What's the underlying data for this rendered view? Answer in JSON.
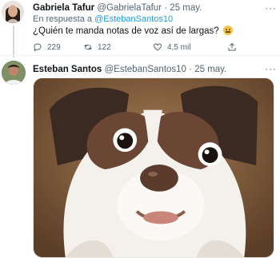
{
  "reply": {
    "author_name": "Gabriela Tafur",
    "handle": "@GabrielaTafur",
    "separator": "·",
    "time": "25 may.",
    "reply_prefix": "En respuesta a",
    "reply_mention": "@EstebanSantos10",
    "text": "¿Quién te manda notas de voz así de largas?",
    "emoji": "thinking-face",
    "stats": {
      "replies": "229",
      "retweets": "122",
      "likes": "4,5 mil"
    }
  },
  "original": {
    "author_name": "Esteban Santos",
    "handle": "@EstebanSantos10",
    "separator": "·",
    "time": "25 may.",
    "media": "dog-photo"
  },
  "icons": {
    "reply": "comment-icon",
    "retweet": "retweet-icon",
    "like": "heart-icon",
    "share": "share-icon",
    "more": "more-icon"
  },
  "colors": {
    "text": "#0f1419",
    "secondary": "#536471",
    "link": "#1d9bf0",
    "divider": "#eff3f4"
  }
}
